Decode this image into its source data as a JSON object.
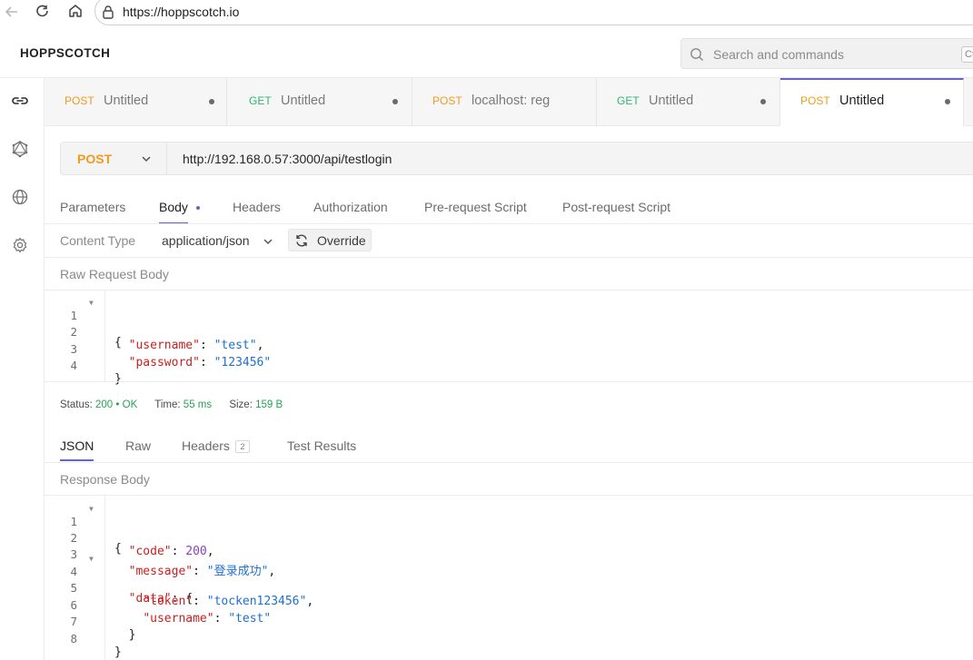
{
  "browser": {
    "url": "https://hoppscotch.io"
  },
  "app": {
    "brand": "HOPPSCOTCH",
    "search_placeholder": "Search and commands",
    "search_shortcut": "Ct"
  },
  "sidebar": {
    "items": [
      {
        "icon": "link-icon"
      },
      {
        "icon": "graphql-icon"
      },
      {
        "icon": "globe-icon"
      },
      {
        "icon": "gear-icon"
      }
    ]
  },
  "tabs": [
    {
      "method": "POST",
      "title": "Untitled"
    },
    {
      "method": "GET",
      "title": "Untitled"
    },
    {
      "method": "POST",
      "title": "localhost: reg"
    },
    {
      "method": "GET",
      "title": "Untitled"
    },
    {
      "method": "POST",
      "title": "Untitled"
    }
  ],
  "request": {
    "method": "POST",
    "url": "http://192.168.0.57:3000/api/testlogin"
  },
  "request_tabs": [
    "Parameters",
    "Body",
    "Headers",
    "Authorization",
    "Pre-request Script",
    "Post-request Script"
  ],
  "body": {
    "content_type_label": "Content Type",
    "content_type": "application/json",
    "override_label": "Override",
    "raw_label": "Raw Request Body",
    "lines": [
      "1",
      "2",
      "3",
      "4"
    ],
    "username_key": "\"username\"",
    "username_value": "\"test\"",
    "password_key": "\"password\"",
    "password_value": "\"123456\""
  },
  "status": {
    "status_label": "Status:",
    "status_code": "200",
    "status_text": "OK",
    "time_label": "Time:",
    "time_value": "55 ms",
    "size_label": "Size:",
    "size_value": "159 B"
  },
  "response_tabs": {
    "json": "JSON",
    "raw": "Raw",
    "headers": "Headers",
    "headers_count": "2",
    "tests": "Test Results"
  },
  "response": {
    "label": "Response Body",
    "lines": [
      "1",
      "2",
      "3",
      "4",
      "5",
      "6",
      "7",
      "8"
    ],
    "code_key": "\"code\"",
    "code_value": "200",
    "message_key": "\"message\"",
    "message_value": "\"登录成功\"",
    "data_key": "\"data\"",
    "token_key": "\"token\"",
    "token_value": "\"tocken123456\"",
    "username_key": "\"username\"",
    "username_value": "\"test\""
  }
}
